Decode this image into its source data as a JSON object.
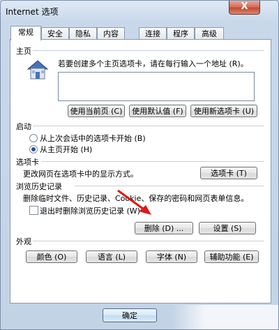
{
  "window": {
    "title": "Internet 选项",
    "close_label": "X"
  },
  "tabs": [
    {
      "label": "常规",
      "active": true
    },
    {
      "label": "安全"
    },
    {
      "label": "隐私"
    },
    {
      "label": "内容"
    },
    {
      "label": "连接"
    },
    {
      "label": "程序"
    },
    {
      "label": "高级"
    }
  ],
  "homepage": {
    "section_title": "主页",
    "description": "若要创建多个主页选项卡，请在每行输入一个地址 (R)。",
    "value": "",
    "buttons": [
      "使用当前页 (C)",
      "使用默认值 (F)",
      "使用新选项卡 (U)"
    ]
  },
  "startup": {
    "section_title": "启动",
    "options": [
      {
        "label": "从上次会话中的选项卡开始 (B)",
        "checked": false
      },
      {
        "label": "从主页开始 (H)",
        "checked": true
      }
    ]
  },
  "tabs_section": {
    "section_title": "选项卡",
    "description": "更改网页在选项卡中的显示方式。",
    "button": "选项卡 (T)"
  },
  "history": {
    "section_title": "浏览历史记录",
    "description": "删除临时文件、历史记录、Cookie、保存的密码和网页表单信息。",
    "checkbox_label": "退出时删除浏览历史记录 (W)",
    "delete_button": "删除 (D) ...",
    "settings_button": "设置 (S)"
  },
  "appearance": {
    "section_title": "外观",
    "buttons": [
      "颜色 (O)",
      "语言 (L)",
      "字体 (N)",
      "辅助功能 (E)"
    ]
  },
  "footer": {
    "ok_button": "确定"
  },
  "colors": {
    "arrow": "#e01818",
    "accent": "#2b4f8a"
  }
}
